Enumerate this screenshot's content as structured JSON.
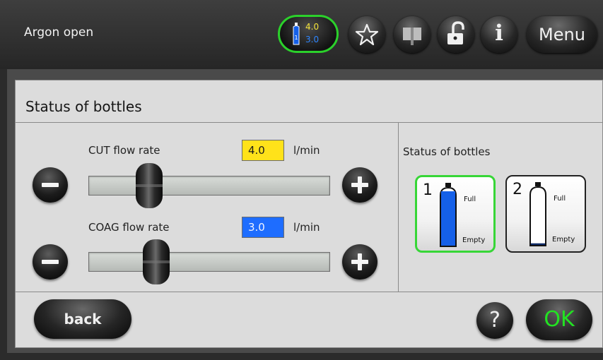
{
  "header": {
    "title": "Argon open",
    "flow_badge": {
      "bottle_number": "1",
      "cut_value": "4.0",
      "coag_value": "3.0"
    },
    "buttons": [
      {
        "name": "favorites",
        "icon": "star-icon"
      },
      {
        "name": "manual",
        "icon": "book-icon"
      },
      {
        "name": "lock",
        "icon": "unlock-icon"
      },
      {
        "name": "info",
        "icon": "info-icon",
        "glyph": "i"
      }
    ],
    "menu_label": "Menu"
  },
  "panel": {
    "title": "Status of bottles",
    "cut": {
      "label": "CUT flow rate",
      "value": "4.0",
      "unit": "l/min",
      "slider_fraction": 0.25,
      "color": "#ffe21a"
    },
    "coag": {
      "label": "COAG flow rate",
      "value": "3.0",
      "unit": "l/min",
      "slider_fraction": 0.28,
      "color": "#1e6dff"
    },
    "bottles_title": "Status of bottles",
    "bottles": [
      {
        "number": "1",
        "full_label": "Full",
        "empty_label": "Empty",
        "selected": true,
        "fill_fraction": 1.0,
        "fill_color": "#1560e8"
      },
      {
        "number": "2",
        "full_label": "Full",
        "empty_label": "Empty",
        "selected": false,
        "fill_fraction": 0.03,
        "fill_color": "#0d2a66"
      }
    ]
  },
  "footer": {
    "back_label": "back",
    "help_glyph": "?",
    "ok_label": "OK"
  },
  "colors": {
    "selected_border": "#37d637",
    "ok_text": "#22e322"
  }
}
